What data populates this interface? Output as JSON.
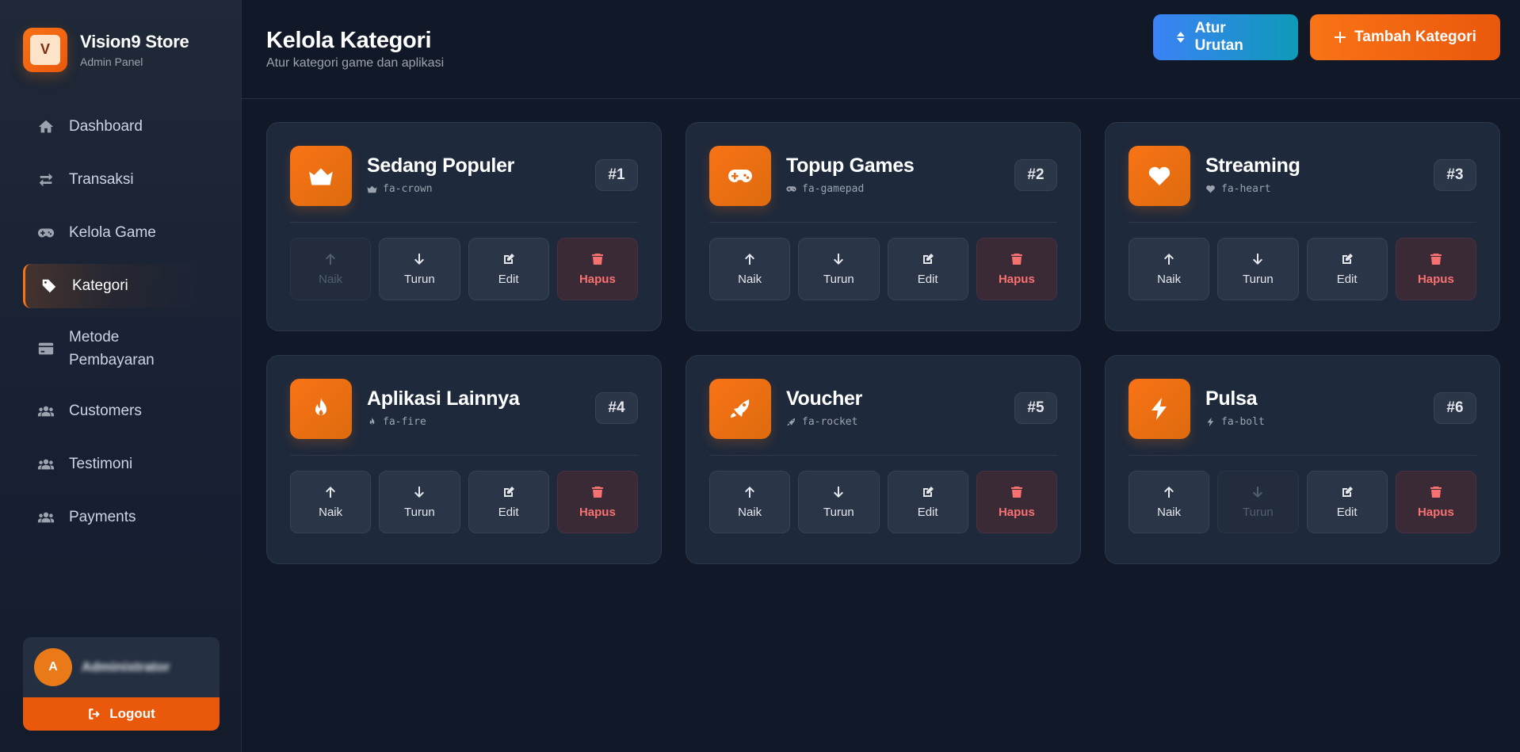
{
  "sidebar": {
    "brand_title": "Vision9 Store",
    "brand_sub": "Admin Panel",
    "brand_logo_text": "V",
    "items": [
      {
        "label": "Dashboard",
        "icon": "home-icon"
      },
      {
        "label": "Transaksi",
        "icon": "exchange-icon"
      },
      {
        "label": "Kelola Game",
        "icon": "gamepad-icon"
      },
      {
        "label": "Kategori",
        "icon": "tags-icon",
        "active": true
      },
      {
        "label": "Metode Pembayaran",
        "icon": "credit-card-icon"
      },
      {
        "label": "Customers",
        "icon": "users-icon"
      },
      {
        "label": "Testimoni",
        "icon": "users-icon"
      },
      {
        "label": "Payments",
        "icon": "users-icon"
      }
    ],
    "user": {
      "initial": "A",
      "name": "Administrator"
    },
    "logout_label": "Logout"
  },
  "header": {
    "title": "Kelola Kategori",
    "subtitle": "Atur kategori game dan aplikasi",
    "sort_label": "Atur Urutan",
    "add_label": "Tambah Kategori"
  },
  "actions": {
    "up": "Naik",
    "down": "Turun",
    "edit": "Edit",
    "delete": "Hapus"
  },
  "categories": [
    {
      "name": "Sedang Populer",
      "code": "fa-crown",
      "order": "#1",
      "icon": "crown-icon",
      "up_disabled": true,
      "down_disabled": false
    },
    {
      "name": "Topup Games",
      "code": "fa-gamepad",
      "order": "#2",
      "icon": "gamepad-icon",
      "up_disabled": false,
      "down_disabled": false
    },
    {
      "name": "Streaming",
      "code": "fa-heart",
      "order": "#3",
      "icon": "heart-icon",
      "up_disabled": false,
      "down_disabled": false
    },
    {
      "name": "Aplikasi Lainnya",
      "code": "fa-fire",
      "order": "#4",
      "icon": "fire-icon",
      "up_disabled": false,
      "down_disabled": false
    },
    {
      "name": "Voucher",
      "code": "fa-rocket",
      "order": "#5",
      "icon": "rocket-icon",
      "up_disabled": false,
      "down_disabled": false
    },
    {
      "name": "Pulsa",
      "code": "fa-bolt",
      "order": "#6",
      "icon": "bolt-icon",
      "up_disabled": false,
      "down_disabled": true
    }
  ],
  "colors": {
    "accent": "#f97316",
    "accent_dark": "#ea580c",
    "sort_gradient_start": "#3b82f6",
    "sort_gradient_end": "#0e9ab8",
    "danger": "#f87171",
    "background": "#111827",
    "card": "#1e293b"
  }
}
